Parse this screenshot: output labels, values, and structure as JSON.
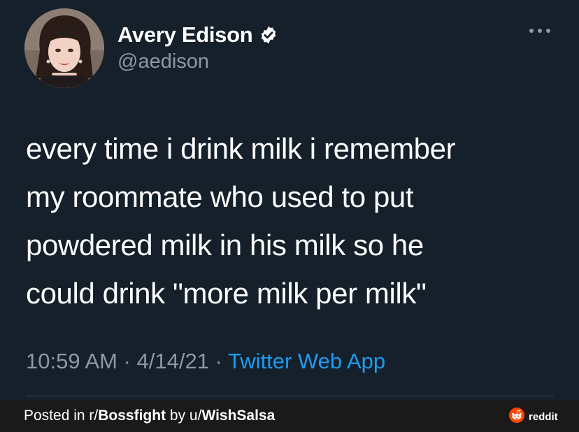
{
  "tweet": {
    "display_name": "Avery Edison",
    "handle": "@aedison",
    "text_lines": [
      "every time i drink milk i remember",
      "my roommate who used to put",
      "powdered milk in his milk so he",
      "could drink \"more milk per milk\""
    ],
    "time": "10:59 AM",
    "separator": " · ",
    "date": "4/14/21",
    "source": "Twitter Web App",
    "more_icon": "ellipsis-icon",
    "verified_icon": "verified-badge-icon"
  },
  "footer": {
    "posted_in": "Posted in r/",
    "subreddit": "Bossfight",
    "by": " by u/",
    "user": "WishSalsa",
    "brand": "reddit",
    "brand_icon": "reddit-snoo-icon"
  },
  "colors": {
    "background": "#15202b",
    "text": "#ffffff",
    "secondary": "#8b98a5",
    "link": "#1d9bf0",
    "footer_bg": "#1a1a1b",
    "reddit_orange": "#ff4500"
  }
}
